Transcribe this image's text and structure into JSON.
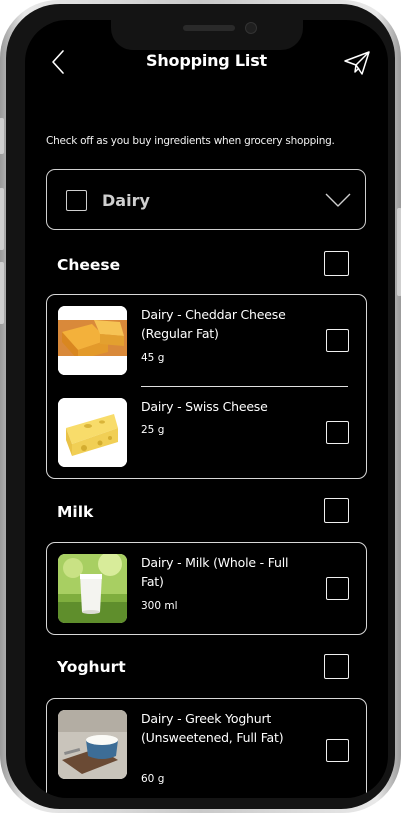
{
  "header": {
    "title": "Shopping List",
    "back_icon": "chevron-left-icon",
    "send_icon": "paper-plane-icon"
  },
  "instructions": "Check off as you buy ingredients when grocery shopping.",
  "category": {
    "label": "Dairy",
    "checked": false,
    "expand_icon": "chevron-down-icon"
  },
  "sections": [
    {
      "title": "Cheese",
      "items": [
        {
          "name": "Dairy - Cheddar Cheese (Regular Fat)",
          "qty": "45 g",
          "image": "cheddar-cheese-image"
        },
        {
          "name": "Dairy - Swiss Cheese",
          "qty": "25 g",
          "image": "swiss-cheese-image"
        }
      ]
    },
    {
      "title": "Milk",
      "items": [
        {
          "name": "Dairy - Milk (Whole - Full Fat)",
          "qty": "300 ml",
          "image": "milk-glass-image"
        }
      ]
    },
    {
      "title": "Yoghurt",
      "items": [
        {
          "name": "Dairy - Greek Yoghurt (Unsweetened, Full Fat)",
          "qty": "60 g",
          "image": "yoghurt-bowl-image"
        }
      ]
    }
  ]
}
